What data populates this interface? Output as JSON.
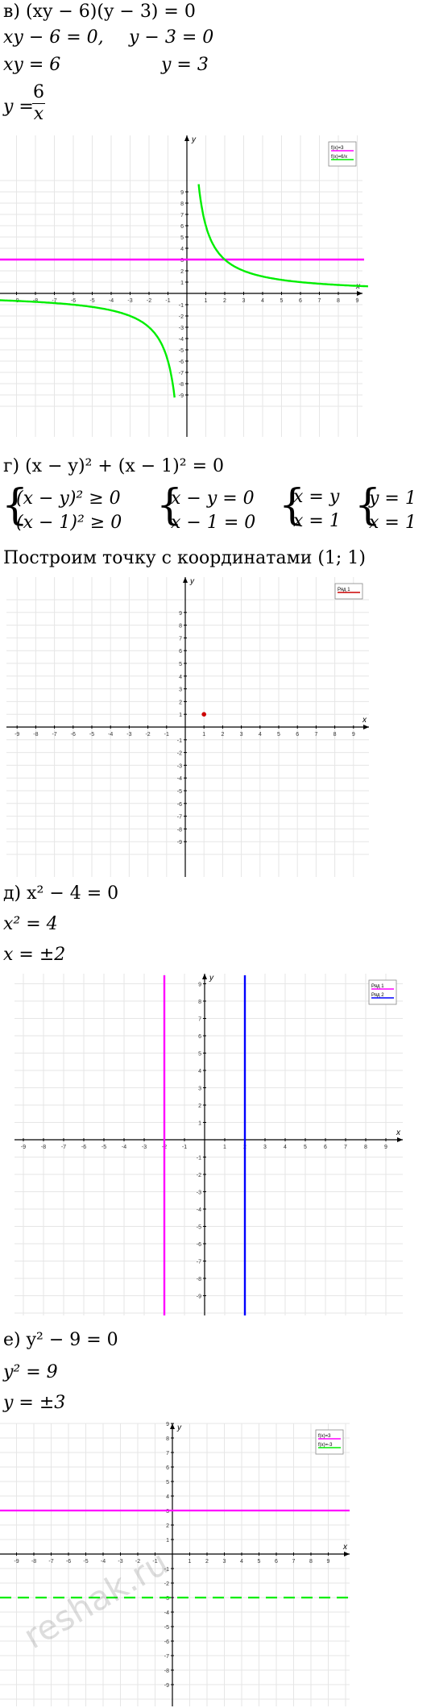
{
  "sections": {
    "v": {
      "lines": [
        "в) (xy − 6)(y − 3) = 0",
        "xy − 6 = 0,",
        "y − 3 = 0",
        "xy = 6",
        "y = 3",
        "y =",
        "6",
        "x"
      ]
    },
    "g": {
      "lines": [
        "г) (x − y)² + (x − 1)² = 0",
        "(x − y)² ≥ 0",
        "(x − 1)² ≥ 0",
        "x − y = 0",
        "x − 1 = 0",
        "x = y",
        "x = 1",
        "y = 1",
        "x = 1",
        "Построим точку с координатами (1; 1)"
      ]
    },
    "d": {
      "lines": [
        "д) x² − 4 = 0",
        "x² = 4",
        "x = ±2"
      ]
    },
    "e": {
      "lines": [
        "е) y² − 9 = 0",
        "y² = 9",
        "y = ±3"
      ]
    }
  },
  "graphs": [
    {
      "axis_x": "x",
      "axis_y": "y",
      "ticks": [
        "-9",
        "-8",
        "-7",
        "-6",
        "-5",
        "-4",
        "-3",
        "-2",
        "-1",
        "1",
        "2",
        "3",
        "4",
        "5",
        "6",
        "7",
        "8",
        "9"
      ],
      "legend": [
        "f(x)=3",
        "f(x)=6/x"
      ],
      "colors": [
        "#ff00ff",
        "#00ee00"
      ]
    },
    {
      "axis_x": "x",
      "axis_y": "y",
      "ticks": [
        "-9",
        "-8",
        "-7",
        "-6",
        "-5",
        "-4",
        "-3",
        "-2",
        "-1",
        "1",
        "2",
        "3",
        "4",
        "5",
        "6",
        "7",
        "8",
        "9"
      ],
      "legend": [
        "Ряд 1"
      ],
      "colors": [
        "#cc0000"
      ]
    },
    {
      "axis_x": "x",
      "axis_y": "y",
      "ticks": [
        "-9",
        "-8",
        "-7",
        "-6",
        "-5",
        "-4",
        "-3",
        "-2",
        "-1",
        "1",
        "2",
        "3",
        "4",
        "5",
        "6",
        "7",
        "8",
        "9"
      ],
      "legend": [
        "Ряд 1",
        "Ряд 2"
      ],
      "colors": [
        "#ff00ff",
        "#0000ff"
      ]
    },
    {
      "axis_x": "x",
      "axis_y": "y",
      "ticks": [
        "-9",
        "-8",
        "-7",
        "-6",
        "-5",
        "-4",
        "-3",
        "-2",
        "-1",
        "1",
        "2",
        "3",
        "4",
        "5",
        "6",
        "7",
        "8",
        "9"
      ],
      "legend": [
        "f(x)=3",
        "f(x)=-3"
      ],
      "colors": [
        "#ff00ff",
        "#00ee00"
      ]
    }
  ],
  "chart_data": [
    {
      "type": "line",
      "series": [
        {
          "name": "f(x)=3",
          "function": "y=3"
        },
        {
          "name": "f(x)=6/x",
          "function": "y=6/x"
        }
      ],
      "xlim": [
        -10,
        10
      ],
      "ylim": [
        -10,
        10
      ]
    },
    {
      "type": "scatter",
      "series": [
        {
          "name": "Ряд 1",
          "points": [
            [
              1,
              1
            ]
          ]
        }
      ],
      "xlim": [
        -10,
        10
      ],
      "ylim": [
        -10,
        10
      ]
    },
    {
      "type": "line",
      "series": [
        {
          "name": "Ряд 1",
          "function": "x=-2"
        },
        {
          "name": "Ряд 2",
          "function": "x=2"
        }
      ],
      "xlim": [
        -10,
        10
      ],
      "ylim": [
        -10,
        10
      ]
    },
    {
      "type": "line",
      "series": [
        {
          "name": "f(x)=3",
          "function": "y=3"
        },
        {
          "name": "f(x)=-3",
          "function": "y=-3",
          "style": "dashed"
        }
      ],
      "xlim": [
        -10,
        10
      ],
      "ylim": [
        -10,
        10
      ]
    }
  ],
  "watermark": "reshak.ru"
}
